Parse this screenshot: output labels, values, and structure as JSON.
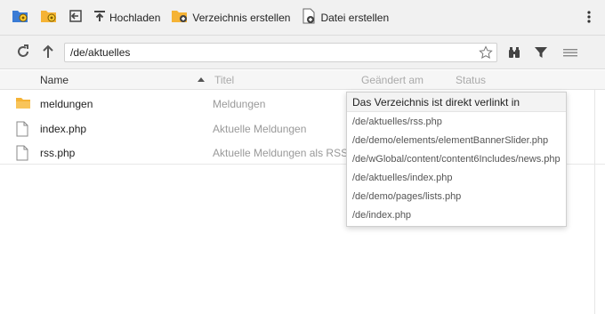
{
  "toolbar": {
    "upload_label": "Hochladen",
    "create_dir_label": "Verzeichnis erstellen",
    "create_file_label": "Datei erstellen",
    "icons": [
      "settings-folder-icon",
      "settings-gear-icon",
      "exit-icon",
      "upload-icon",
      "new-folder-icon",
      "new-file-icon",
      "more-vertical-icon"
    ]
  },
  "path": {
    "value": "/de/aktuelles",
    "icons": [
      "refresh-icon",
      "up-arrow-icon",
      "star-icon",
      "binoculars-icon",
      "filter-icon",
      "list-view-icon"
    ]
  },
  "table": {
    "columns": {
      "name": "Name",
      "title": "Titel",
      "modified": "Geändert am",
      "status": "Status"
    },
    "rows": [
      {
        "name": "meldungen",
        "title": "Meldungen",
        "icon": "folder-icon"
      },
      {
        "name": "index.php",
        "title": "Aktuelle Meldungen",
        "icon": "file-icon"
      },
      {
        "name": "rss.php",
        "title": "Aktuelle Meldungen als RSS",
        "icon": "file-icon"
      }
    ]
  },
  "popup": {
    "title": "Das Verzeichnis ist direkt verlinkt in",
    "items": [
      "/de/aktuelles/rss.php",
      "/de/demo/elements/elementBannerSlider.php",
      "/de/wGlobal/content/content6Includes/news.php",
      "/de/aktuelles/index.php",
      "/de/demo/pages/lists.php",
      "/de/index.php"
    ]
  },
  "colors": {
    "toolbar_bg": "#f1f1f1",
    "folder": "#f5b335",
    "icon_blue": "#3a7bd5",
    "icon_dark": "#444444"
  }
}
